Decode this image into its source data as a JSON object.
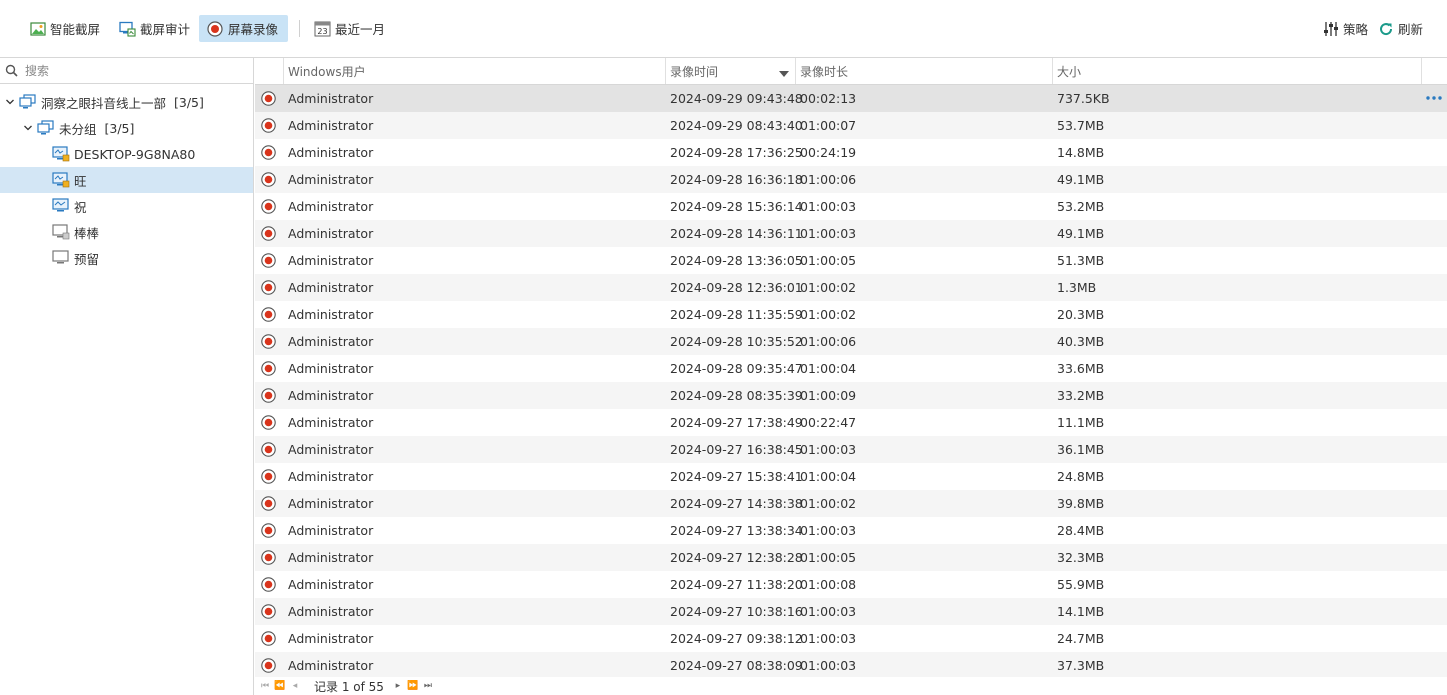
{
  "toolbar": {
    "smart_screenshot": "智能截屏",
    "screenshot_audit": "截屏审计",
    "screen_recording": "屏幕录像",
    "date_range": "最近一月",
    "calendar_day": "23",
    "policy": "策略",
    "refresh": "刷新"
  },
  "search": {
    "placeholder": "搜索"
  },
  "tree": [
    {
      "label": "洞察之眼抖音线上一部",
      "count": "[3/5]"
    },
    {
      "label": "未分组",
      "count": "[3/5]"
    },
    {
      "label": "DESKTOP-9G8NA80"
    },
    {
      "label": "旺"
    },
    {
      "label": "祝"
    },
    {
      "label": "棒棒"
    },
    {
      "label": "预留"
    }
  ],
  "columns": {
    "user": "Windows用户",
    "time": "录像时间",
    "duration": "录像时长",
    "size": "大小"
  },
  "rows": [
    {
      "user": "Administrator",
      "time": "2024-09-29 09:43:48",
      "duration": "00:02:13",
      "size": "737.5KB"
    },
    {
      "user": "Administrator",
      "time": "2024-09-29 08:43:40",
      "duration": "01:00:07",
      "size": "53.7MB"
    },
    {
      "user": "Administrator",
      "time": "2024-09-28 17:36:25",
      "duration": "00:24:19",
      "size": "14.8MB"
    },
    {
      "user": "Administrator",
      "time": "2024-09-28 16:36:18",
      "duration": "01:00:06",
      "size": "49.1MB"
    },
    {
      "user": "Administrator",
      "time": "2024-09-28 15:36:14",
      "duration": "01:00:03",
      "size": "53.2MB"
    },
    {
      "user": "Administrator",
      "time": "2024-09-28 14:36:11",
      "duration": "01:00:03",
      "size": "49.1MB"
    },
    {
      "user": "Administrator",
      "time": "2024-09-28 13:36:05",
      "duration": "01:00:05",
      "size": "51.3MB"
    },
    {
      "user": "Administrator",
      "time": "2024-09-28 12:36:01",
      "duration": "01:00:02",
      "size": "1.3MB"
    },
    {
      "user": "Administrator",
      "time": "2024-09-28 11:35:59",
      "duration": "01:00:02",
      "size": "20.3MB"
    },
    {
      "user": "Administrator",
      "time": "2024-09-28 10:35:52",
      "duration": "01:00:06",
      "size": "40.3MB"
    },
    {
      "user": "Administrator",
      "time": "2024-09-28 09:35:47",
      "duration": "01:00:04",
      "size": "33.6MB"
    },
    {
      "user": "Administrator",
      "time": "2024-09-28 08:35:39",
      "duration": "01:00:09",
      "size": "33.2MB"
    },
    {
      "user": "Administrator",
      "time": "2024-09-27 17:38:49",
      "duration": "00:22:47",
      "size": "11.1MB"
    },
    {
      "user": "Administrator",
      "time": "2024-09-27 16:38:45",
      "duration": "01:00:03",
      "size": "36.1MB"
    },
    {
      "user": "Administrator",
      "time": "2024-09-27 15:38:41",
      "duration": "01:00:04",
      "size": "24.8MB"
    },
    {
      "user": "Administrator",
      "time": "2024-09-27 14:38:38",
      "duration": "01:00:02",
      "size": "39.8MB"
    },
    {
      "user": "Administrator",
      "time": "2024-09-27 13:38:34",
      "duration": "01:00:03",
      "size": "28.4MB"
    },
    {
      "user": "Administrator",
      "time": "2024-09-27 12:38:28",
      "duration": "01:00:05",
      "size": "32.3MB"
    },
    {
      "user": "Administrator",
      "time": "2024-09-27 11:38:20",
      "duration": "01:00:08",
      "size": "55.9MB"
    },
    {
      "user": "Administrator",
      "time": "2024-09-27 10:38:16",
      "duration": "01:00:03",
      "size": "14.1MB"
    },
    {
      "user": "Administrator",
      "time": "2024-09-27 09:38:12",
      "duration": "01:00:03",
      "size": "24.7MB"
    },
    {
      "user": "Administrator",
      "time": "2024-09-27 08:38:09",
      "duration": "01:00:03",
      "size": "37.3MB"
    }
  ],
  "pager": {
    "label": "记录 1 of 55"
  },
  "colors": {
    "accent": "#c9e3f6",
    "selected_tree": "#d3e6f5",
    "record_red": "#d9341c",
    "icon_blue": "#2a7ac0"
  }
}
